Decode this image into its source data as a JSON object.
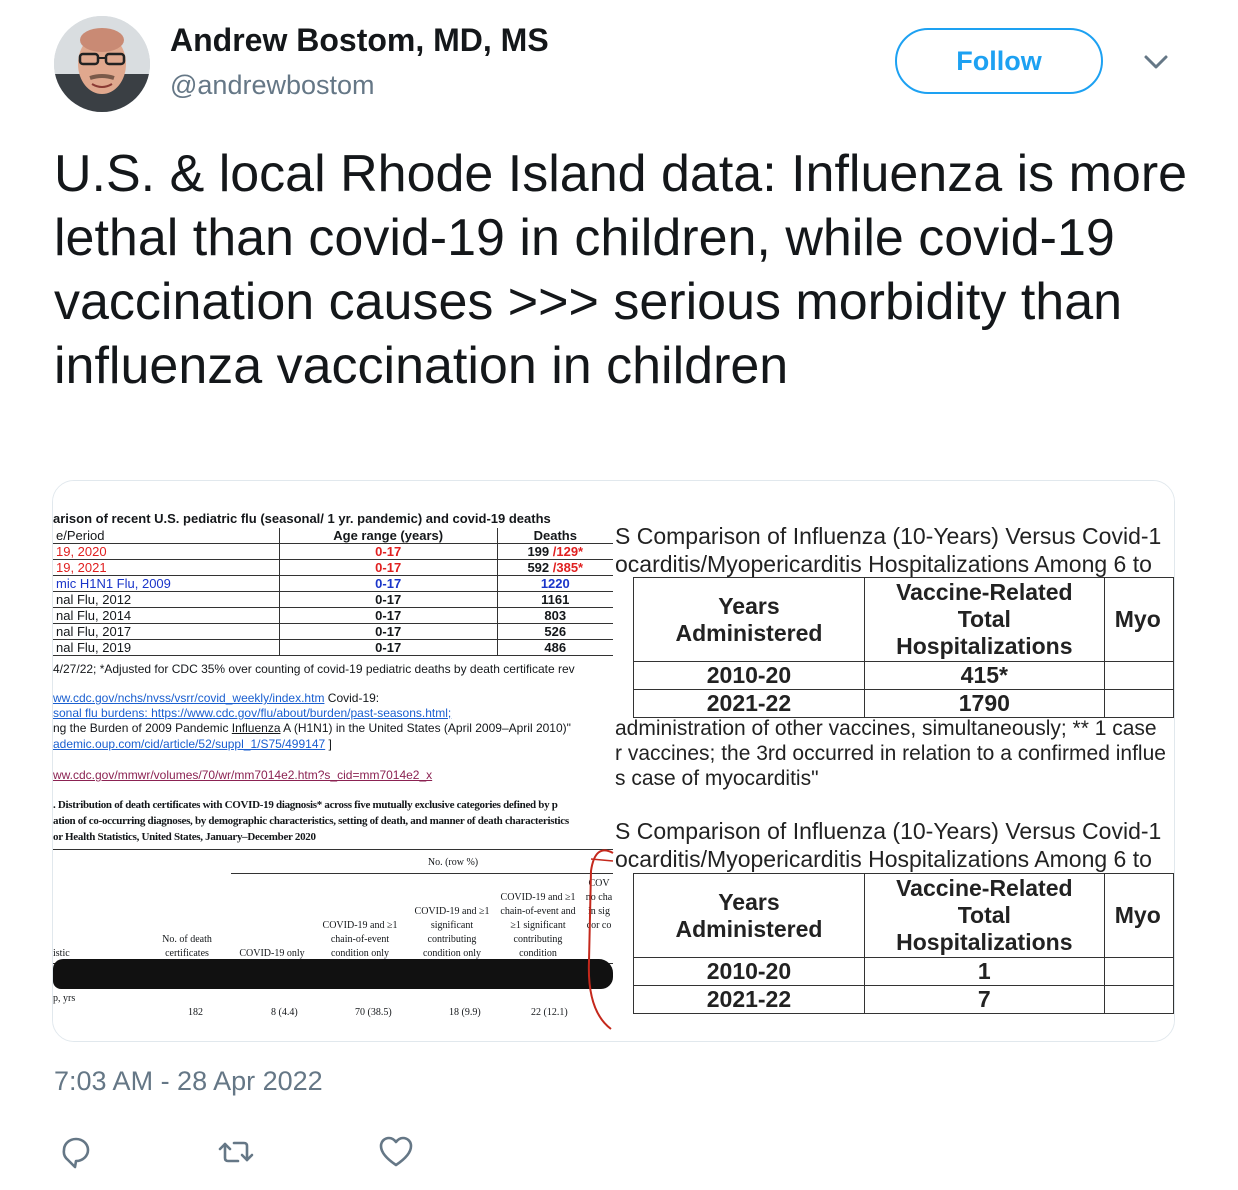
{
  "author": {
    "name": "Andrew Bostom, MD, MS",
    "handle": "@andrewbostom"
  },
  "follow_label": "Follow",
  "tweet_text": "U.S. & local Rhode Island data: Influenza is more lethal than covid-19 in children, while covid-19 vaccination causes >>> serious morbidity than influenza vaccination in children",
  "timestamp": "7:03 AM - 28 Apr 2022",
  "media": {
    "left": {
      "title": "arison of recent U.S. pediatric flu (seasonal/ 1 yr. pandemic) and covid-19 deaths",
      "headers": [
        "e/Period",
        "Age range (years)",
        "Deaths"
      ],
      "rows": [
        {
          "period": "19, 2020",
          "age": "0-17",
          "deaths": "199 ",
          "adj": "/129*"
        },
        {
          "period": "19, 2021",
          "age": "0-17",
          "deaths": "592 ",
          "adj": "/385*"
        },
        {
          "period": "mic H1N1 Flu, 2009",
          "age": "0-17",
          "deaths": "1220",
          "adj": ""
        },
        {
          "period": "nal Flu, 2012",
          "age": "0-17",
          "deaths": "1161",
          "adj": ""
        },
        {
          "period": "nal Flu, 2014",
          "age": "0-17",
          "deaths": "803",
          "adj": ""
        },
        {
          "period": "nal Flu, 2017",
          "age": "0-17",
          "deaths": "526",
          "adj": ""
        },
        {
          "period": "nal Flu, 2019",
          "age": "0-17",
          "deaths": "486",
          "adj": ""
        }
      ],
      "note": " 4/27/22; *Adjusted for CDC 35% over counting of covid-19 pediatric deaths by death certificate rev",
      "link1": "ww.cdc.gov/nchs/nvss/vsrr/covid_weekly/index.htm",
      "link1_suffix": " Covid-19:",
      "link2": "sonal flu burdens: https://www.cdc.gov/flu/about/burden/past-seasons.html;",
      "line3_pre": "ng the Burden of 2009 Pandemic ",
      "line3_influenza": "Influenza",
      "line3_post": " A (H1N1) in the United States (April 2009–April 2010)\"",
      "link4": "ademic.oup.com/cid/article/52/suppl_1/S75/499147",
      "link4_suffix": " ]",
      "link5": "ww.cdc.gov/mmwr/volumes/70/wr/mm7014e2.htm?s_cid=mm7014e2_x",
      "fig_caption1": ". Distribution of death certificates with COVID-19 diagnosis* across five mutually exclusive categories defined by p",
      "fig_caption2": "ation of co-occurring diagnoses, by demographic characteristics, setting of death, and manner of death characteristics",
      "fig_caption3": "or Health Statistics, United States, January–December 2020",
      "fig_rowpct": "No. (row %)",
      "fig_headers": [
        "istic",
        "No. of death certificates",
        "COVID-19 only",
        "COVID-19 and ≥1 chain-of-event condition only",
        "COVID-19 and ≥1 significant contributing condition only",
        "COVID-19 and ≥1 chain-of-event and ≥1 significant contributing condition",
        "COV no chain sig cor co"
      ],
      "fig_row_label": "p, yrs",
      "fig_values": [
        "182",
        "8 (4.4)",
        "70 (38.5)",
        "18 (9.9)",
        "22 (12.1)"
      ]
    },
    "right": {
      "table1": {
        "title1": "S Comparison of Influenza (10-Years) Versus Covid-1",
        "title2": "ocarditis/Myopericarditis Hospitalizations Among 6 to",
        "col1": [
          "Years",
          "Administered"
        ],
        "col2": [
          "Vaccine-Related",
          "Total",
          "Hospitalizations"
        ],
        "col3": "Myo",
        "rows": [
          {
            "years": "2010-20",
            "value": "415*"
          },
          {
            "years": "2021-22",
            "value": "1790"
          }
        ],
        "note1": "administration of other vaccines, simultaneously; ** 1 case",
        "note2": "r vaccines; the 3rd occurred in relation to a confirmed influe",
        "note3": "s case of myocarditis\""
      },
      "table2": {
        "title1": "S Comparison of Influenza (10-Years) Versus Covid-1",
        "title2": "ocarditis/Myopericarditis Hospitalizations Among 6 to",
        "col1": [
          "Years",
          "Administered"
        ],
        "col2": [
          "Vaccine-Related",
          "Total",
          "Hospitalizations"
        ],
        "col3": "Myo",
        "rows": [
          {
            "years": "2010-20",
            "value": "1"
          },
          {
            "years": "2021-22",
            "value": "7"
          }
        ]
      }
    }
  },
  "actions": [
    "reply-icon",
    "retweet-icon",
    "like-icon"
  ],
  "colors": {
    "accent": "#1da1f2",
    "secondary_text": "#657786",
    "red": "#e02020",
    "blue": "#1a35c9"
  }
}
